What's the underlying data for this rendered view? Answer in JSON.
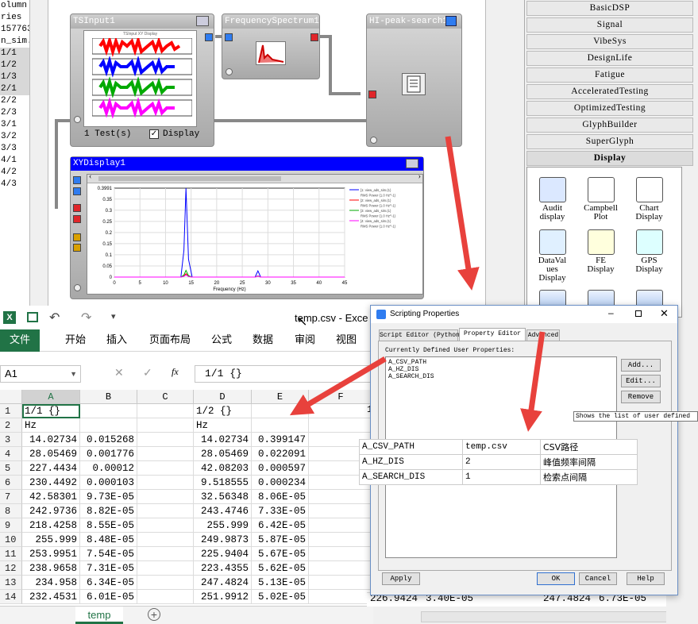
{
  "left_list": [
    "olumn",
    "ries",
    "157763",
    "n_sim.",
    "1/1",
    "1/2",
    "1/3",
    "2/1",
    "2/2",
    "2/3",
    "3/1",
    "3/2",
    "3/3",
    "4/1",
    "4/2",
    "4/3"
  ],
  "blocks": {
    "tsinput": {
      "title": "TSInput1",
      "tests": "1 Test(s)",
      "display": "Display",
      "plot_title": "TSInput XY Display"
    },
    "spectrum": {
      "title": "FrequencySpectrum1",
      "icon": "f(t)"
    },
    "peak": {
      "title": "HI-peak-search1"
    },
    "xy": {
      "title": "XYDisplay1",
      "ymax": "0.3991",
      "y_ticks": [
        "0.35",
        "0.3",
        "0.25",
        "0.2",
        "0.15",
        "0.1",
        "0.05",
        "0"
      ],
      "x_ticks": [
        "0",
        "5",
        "10",
        "15",
        "20",
        "25",
        "30",
        "35",
        "40",
        "45"
      ],
      "xlabel": "Frequency (Hz)",
      "legend": [
        "[1: view_ads_sim.(1)",
        "RMS Power (1.0 Hz^-1)",
        "[2: view_ads_sim.(1)",
        "RMS Power (1.0 Hz^-1)",
        "[3: view_ads_sim.(1)",
        "RMS Power (1.0 Hz^-1)",
        "[4: view_ads_sim.(1)",
        "RMS Power (1.0 Hz^-1)"
      ]
    }
  },
  "right_panel": {
    "items": [
      "BasicDSP",
      "Signal",
      "VibeSys",
      "DesignLife",
      "Fatigue",
      "AcceleratedTesting",
      "OptimizedTesting",
      "GlyphBuilder",
      "SuperGlyph",
      "Display"
    ],
    "display_items": [
      [
        "Audit",
        "display"
      ],
      [
        "Campbell",
        "Plot"
      ],
      [
        "Chart",
        "Display"
      ],
      [
        "DataVal",
        "ues",
        "Display"
      ],
      [
        "FE",
        "Display"
      ],
      [
        "GPS",
        "Display"
      ]
    ],
    "audit_icon": "audit"
  },
  "excel": {
    "title": "temp.csv - Exce",
    "ribbon": [
      "文件",
      "开始",
      "插入",
      "页面布局",
      "公式",
      "数据",
      "审阅",
      "视图"
    ],
    "name_box": "A1",
    "formula": "1/1 {}",
    "fx": "fx",
    "columns": [
      "A",
      "B",
      "C",
      "D",
      "E",
      "F"
    ],
    "rows": [
      [
        "1",
        "1/1 {}",
        "",
        "",
        "1/2 {}",
        "",
        ""
      ],
      [
        "2",
        "Hz",
        "",
        "",
        "Hz",
        "",
        ""
      ],
      [
        "3",
        "14.02734",
        "0.015268",
        "",
        "14.02734",
        "0.399147",
        ""
      ],
      [
        "4",
        "28.05469",
        "0.001776",
        "",
        "28.05469",
        "0.022091",
        ""
      ],
      [
        "5",
        "227.4434",
        "0.00012",
        "",
        "42.08203",
        "0.000597",
        ""
      ],
      [
        "6",
        "230.4492",
        "0.000103",
        "",
        "9.518555",
        "0.000234",
        ""
      ],
      [
        "7",
        "42.58301",
        "9.73E-05",
        "",
        "32.56348",
        "8.06E-05",
        ""
      ],
      [
        "8",
        "242.9736",
        "8.82E-05",
        "",
        "243.4746",
        "7.33E-05",
        ""
      ],
      [
        "9",
        "218.4258",
        "8.55E-05",
        "",
        "255.999",
        "6.42E-05",
        ""
      ],
      [
        "10",
        "255.999",
        "8.48E-05",
        "",
        "249.9873",
        "5.87E-05",
        ""
      ],
      [
        "11",
        "253.9951",
        "7.54E-05",
        "",
        "225.9404",
        "5.67E-05",
        ""
      ],
      [
        "12",
        "238.9658",
        "7.31E-05",
        "",
        "223.4355",
        "5.62E-05",
        ""
      ],
      [
        "13",
        "234.958",
        "6.34E-05",
        "",
        "247.4824",
        "5.13E-05",
        ""
      ],
      [
        "14",
        "232.4531",
        "6.01E-05",
        "",
        "251.9912",
        "5.02E-05",
        ""
      ]
    ],
    "sheet_tab": "temp",
    "extra_col_g1": "1",
    "row14_extra": [
      "226.9424",
      "3.40E-05",
      "247.4824",
      "6.73E-05"
    ]
  },
  "dialog": {
    "title": "Scripting Properties",
    "tabs": [
      "Script Editor (Python)",
      "Property Editor",
      "Advanced"
    ],
    "section": "Currently Defined User Properties:",
    "props": [
      "A_CSV_PATH",
      "A_HZ_DIS",
      "A_SEARCH_DIS"
    ],
    "buttons": [
      "Add...",
      "Edit...",
      "Remove"
    ],
    "tooltip": "Shows the list of user defined",
    "bottom_buttons": [
      "Apply",
      "OK",
      "Cancel",
      "Help"
    ]
  },
  "prop_table": [
    [
      "A_CSV_PATH",
      "temp.csv",
      "CSV路径"
    ],
    [
      "A_HZ_DIS",
      "2",
      "峰值频率间隔"
    ],
    [
      "A_SEARCH_DIS",
      "1",
      "检索点间隔"
    ]
  ],
  "colors": {
    "excel_green": "#217346",
    "arrow_red": "#e8413c",
    "title_blue": "#0000ff"
  }
}
